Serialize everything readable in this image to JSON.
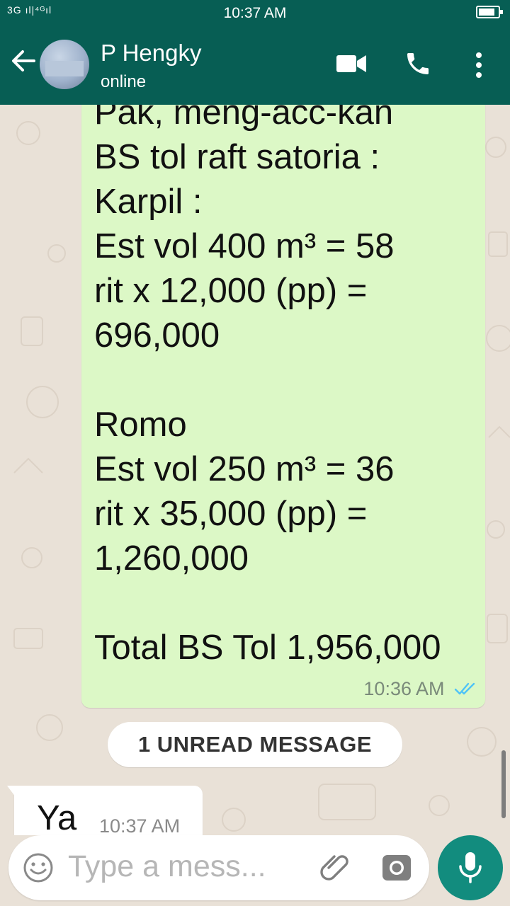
{
  "status_bar": {
    "signal_text": "3G ıl|⁴ᴳıl",
    "time": "10:37 AM"
  },
  "header": {
    "name": "P Hengky",
    "status": "online"
  },
  "messages": {
    "outgoing_text": "Pak,  meng-acc-kan\nBS tol raft satoria :\nKarpil :\nEst vol 400 m³ = 58\nrit x 12,000 (pp)  =\n696,000\n\nRomo\nEst vol 250 m³ = 36\nrit x 35,000 (pp)  =\n1,260,000\n\nTotal BS Tol 1,956,000",
    "outgoing_time": "10:36 AM",
    "unread_label": "1 UNREAD MESSAGE",
    "incoming_text": "Ya",
    "incoming_time": "10:37 AM"
  },
  "composer": {
    "placeholder": "Type a mess..."
  },
  "colors": {
    "header": "#075e54",
    "outgoing_bubble": "#dcf8c6",
    "fab": "#128c7e",
    "read_ticks": "#4fc3f7"
  },
  "icons": [
    "back-arrow-icon",
    "video-call-icon",
    "phone-icon",
    "more-vert-icon",
    "emoji-icon",
    "attach-icon",
    "camera-icon",
    "mic-icon",
    "double-check-icon"
  ]
}
